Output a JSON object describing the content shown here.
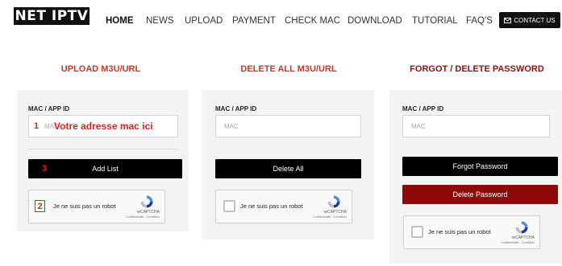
{
  "header": {
    "logo": "NET IPTV",
    "nav": [
      "HOME",
      "NEWS",
      "UPLOAD",
      "PAYMENT",
      "CHECK MAC",
      "DOWNLOAD",
      "TUTORIAL",
      "FAQ'S"
    ],
    "contact_label": "CONTACT US"
  },
  "upload": {
    "title": "UPLOAD M3U/URL",
    "field_label": "MAC / APP ID",
    "placeholder": "MAC",
    "annotation_text": "Votre adresse mac ici",
    "button_label": "Add List",
    "step1": "1",
    "step2": "2",
    "step3": "3"
  },
  "delete_all": {
    "title": "DELETE ALL M3U/URL",
    "field_label": "MAC / APP ID",
    "placeholder": "MAC",
    "button_label": "Delete All"
  },
  "forgot": {
    "title": "FORGOT / DELETE PASSWORD",
    "field_label": "MAC / APP ID",
    "placeholder": "MAC",
    "forgot_button_label": "Forgot Password",
    "delete_button_label": "Delete Password"
  },
  "captcha": {
    "label": "Je ne suis pas un robot",
    "brand": "reCAPTCHA",
    "links": "Confidentialité - Conditions"
  },
  "colors": {
    "title_red": "#c0392b",
    "delete_password_red": "#8e0a0a",
    "annotation_red": "#e02020",
    "panel_bg": "#f4f4f4"
  }
}
